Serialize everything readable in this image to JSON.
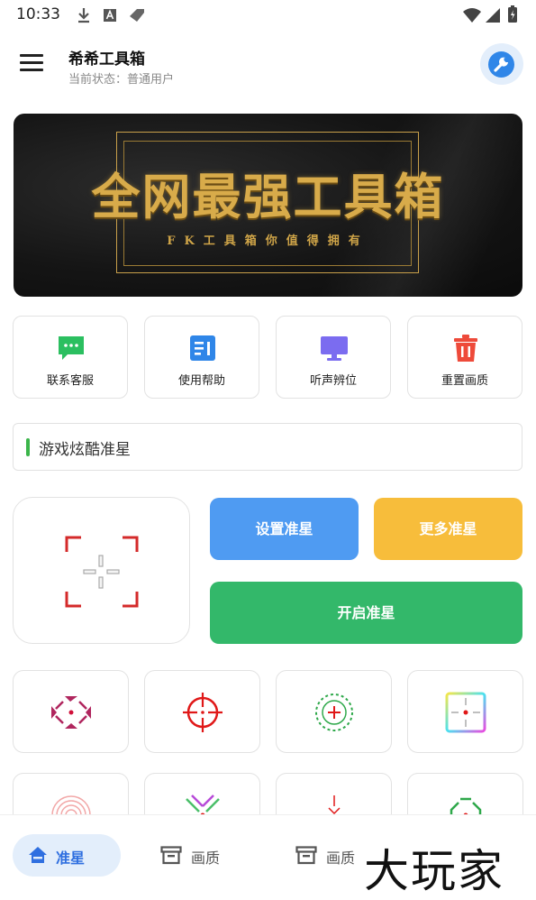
{
  "status_bar": {
    "time": "10:33"
  },
  "app_bar": {
    "title": "希希工具箱",
    "status": "当前状态：普通用户"
  },
  "banner": {
    "title": "全网最强工具箱",
    "subtitle": "FK工具箱你值得拥有"
  },
  "quick_actions": [
    {
      "label": "联系客服",
      "icon": "chat-icon",
      "color": "#2bbf60"
    },
    {
      "label": "使用帮助",
      "icon": "document-icon",
      "color": "#2f86e8"
    },
    {
      "label": "听声辨位",
      "icon": "monitor-icon",
      "color": "#7b6cf0"
    },
    {
      "label": "重置画质",
      "icon": "trash-icon",
      "color": "#ee4a3a"
    }
  ],
  "section": {
    "title": "游戏炫酷准星"
  },
  "buttons": {
    "set": "设置准星",
    "more": "更多准星",
    "enable": "开启准星"
  },
  "colors": {
    "blue": "#4f9bf2",
    "yellow": "#f7bd3b",
    "green": "#33b86a",
    "nav_active": "#2f6fe0"
  },
  "bottom_nav": [
    {
      "label": "准星",
      "icon": "home-icon",
      "active": true
    },
    {
      "label": "画质",
      "icon": "archive-icon",
      "active": false
    },
    {
      "label": "画质",
      "icon": "archive-icon",
      "active": false
    }
  ],
  "watermark": "大玩家"
}
